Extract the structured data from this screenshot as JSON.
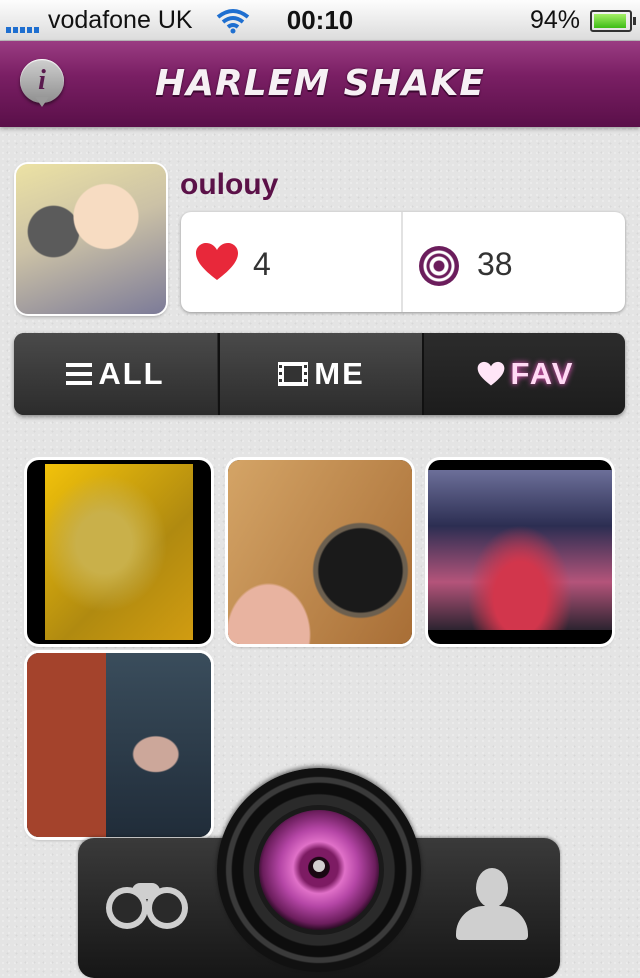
{
  "status_bar": {
    "carrier": "vodafone UK",
    "time": "00:10",
    "battery": "94%"
  },
  "header": {
    "title": "HARLEM SHAKE",
    "info_label": "i"
  },
  "profile": {
    "username": "oulouy",
    "likes": "4",
    "views": "38"
  },
  "tabs": [
    {
      "label": "ALL",
      "icon": "list-icon",
      "active": false
    },
    {
      "label": "ME",
      "icon": "film-icon",
      "active": false
    },
    {
      "label": "FAV",
      "icon": "heart-icon",
      "active": true
    }
  ],
  "videos": [
    {
      "name": "video-thumb-1"
    },
    {
      "name": "video-thumb-2"
    },
    {
      "name": "video-thumb-3"
    },
    {
      "name": "video-thumb-4"
    }
  ],
  "bottom_bar": {
    "left_icon": "binoculars-icon",
    "center_icon": "camera-lens-icon",
    "right_icon": "user-icon"
  },
  "colors": {
    "brand_purple": "#6b1d5c",
    "title_bar": "#7a1f64",
    "heart_red": "#e8283a",
    "fav_glow": "#ff5fd2"
  }
}
